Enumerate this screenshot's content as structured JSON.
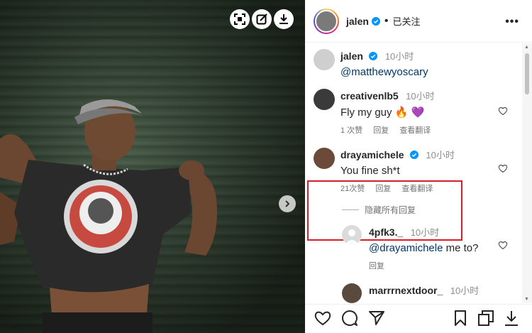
{
  "post": {
    "author": "jalen",
    "follow_status": "已关注",
    "more_label": "•••"
  },
  "caption": {
    "username": "jalen",
    "time": "10小时",
    "text": "@matthewyoscary"
  },
  "comments": [
    {
      "username": "creativenlb5",
      "time": "10小时",
      "text": "Fly my guy 🔥 💜",
      "likes": "1 次赞",
      "reply": "回复",
      "translate": "查看翻译"
    },
    {
      "username": "drayamichele",
      "time": "10小时",
      "text": "You fine sh*t",
      "likes": "21次赞",
      "reply": "回复",
      "translate": "查看翻译"
    }
  ],
  "hide_replies": "隐藏所有回复",
  "reply": {
    "username": "4pfk3._",
    "time": "10小时",
    "mention": "@drayamichele",
    "text": " me to?",
    "reply": "回复"
  },
  "next_comment": {
    "username": "marrrnextdoor_",
    "time": "10小时"
  },
  "colors": {
    "verified": "#0095f6",
    "highlight": "#d3202a",
    "mention": "#00376b"
  }
}
